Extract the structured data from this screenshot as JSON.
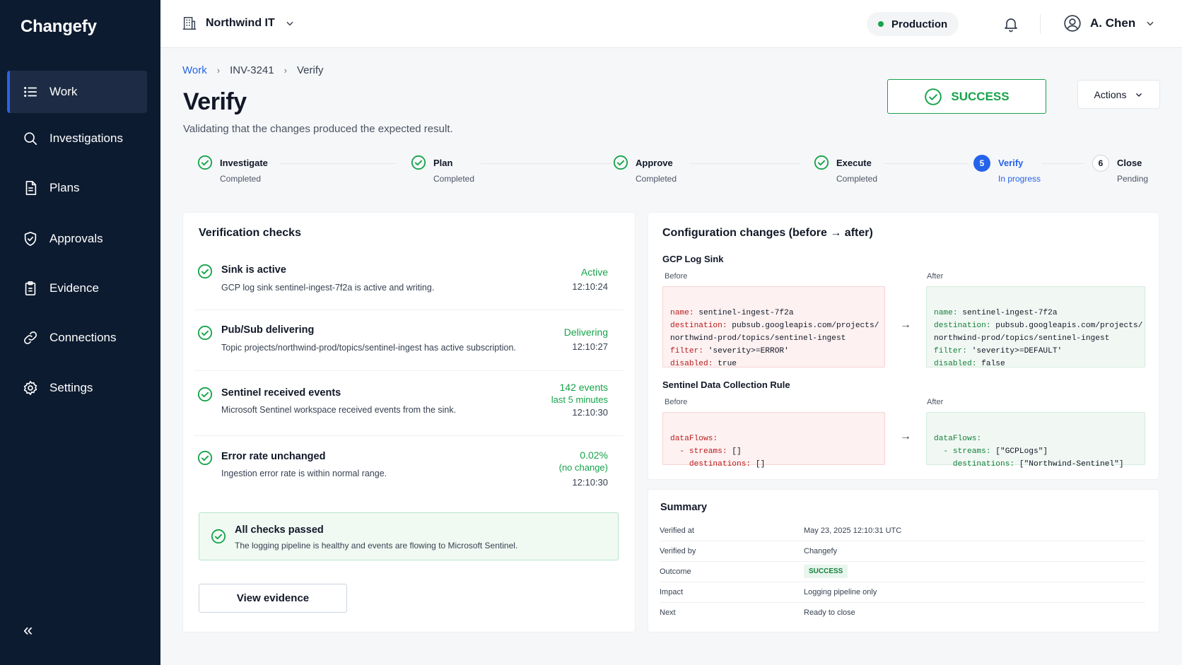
{
  "app": {
    "brand": "Changefy"
  },
  "sidebar": {
    "items": [
      {
        "label": "Work",
        "icon": "list-icon"
      },
      {
        "label": "Investigations",
        "icon": "search-icon"
      },
      {
        "label": "Plans",
        "icon": "document-icon"
      },
      {
        "label": "Approvals",
        "icon": "shield-check-icon"
      },
      {
        "label": "Evidence",
        "icon": "clipboard-icon"
      },
      {
        "label": "Connections",
        "icon": "link-icon"
      },
      {
        "label": "Settings",
        "icon": "gear-icon"
      }
    ],
    "collapse_glyph": "«"
  },
  "topbar": {
    "org": "Northwind IT",
    "environment": "Production",
    "user": "A. Chen"
  },
  "breadcrumb": {
    "root": "Work",
    "item": "INV-3241",
    "current": "Verify",
    "sep": "›"
  },
  "page": {
    "title": "Verify",
    "subtitle": "Validating that the changes produced the expected result.",
    "status_label": "SUCCESS",
    "actions_label": "Actions"
  },
  "steps": [
    {
      "label": "Investigate",
      "status": "Completed",
      "state": "done"
    },
    {
      "label": "Plan",
      "status": "Completed",
      "state": "done"
    },
    {
      "label": "Approve",
      "status": "Completed",
      "state": "done"
    },
    {
      "label": "Execute",
      "status": "Completed",
      "state": "done"
    },
    {
      "num": "5",
      "label": "Verify",
      "status": "In progress",
      "state": "current"
    },
    {
      "num": "6",
      "label": "Close",
      "status": "Pending",
      "state": "pending"
    }
  ],
  "checks": {
    "title": "Verification checks",
    "items": [
      {
        "title": "Sink is active",
        "desc": "GCP log sink sentinel-ingest-7f2a is active and writing.",
        "status": "Active",
        "extra": "",
        "time": "12:10:24"
      },
      {
        "title": "Pub/Sub delivering",
        "desc": "Topic projects/northwind-prod/topics/sentinel-ingest has active subscription.",
        "status": "Delivering",
        "extra": "",
        "time": "12:10:27"
      },
      {
        "title": "Sentinel received events",
        "desc": "Microsoft Sentinel workspace received events from the sink.",
        "status": "142 events",
        "extra": "last 5 minutes",
        "time": "12:10:30"
      },
      {
        "title": "Error rate unchanged",
        "desc": "Ingestion error rate is within normal range.",
        "status": "0.02%",
        "extra": "(no change)",
        "time": "12:10:30"
      }
    ],
    "all_passed_title": "All checks passed",
    "all_passed_desc": "The logging pipeline is healthy and events are flowing to Microsoft Sentinel.",
    "view_evidence": "View evidence"
  },
  "config": {
    "title": "Configuration changes (before → after)",
    "before_label": "Before",
    "after_label": "After",
    "arrow": "→",
    "sections": [
      {
        "name": "GCP Log Sink",
        "before": [
          {
            "k": "name:",
            "v": " sentinel-ingest-7f2a"
          },
          {
            "k": "destination:",
            "v": " pubsub.googleapis.com/projects/"
          },
          {
            "k": "",
            "v": "northwind-prod/topics/sentinel-ingest"
          },
          {
            "k": "filter:",
            "v": " 'severity>=ERROR'"
          },
          {
            "k": "disabled:",
            "v": " true"
          }
        ],
        "after": [
          {
            "k": "name:",
            "v": " sentinel-ingest-7f2a"
          },
          {
            "k": "destination:",
            "v": " pubsub.googleapis.com/projects/"
          },
          {
            "k": "",
            "v": "northwind-prod/topics/sentinel-ingest"
          },
          {
            "k": "filter:",
            "v": " 'severity>=DEFAULT'"
          },
          {
            "k": "disabled:",
            "v": " false"
          }
        ]
      },
      {
        "name": "Sentinel Data Collection Rule",
        "before": [
          {
            "k": "dataFlows:",
            "v": ""
          },
          {
            "k": "  - streams:",
            "v": " []"
          },
          {
            "k": "    destinations:",
            "v": " []"
          }
        ],
        "after": [
          {
            "k": "dataFlows:",
            "v": ""
          },
          {
            "k": "  - streams:",
            "v": " [\"GCPLogs\"]"
          },
          {
            "k": "    destinations:",
            "v": " [\"Northwind-Sentinel\"]"
          }
        ]
      }
    ]
  },
  "summary": {
    "title": "Summary",
    "rows": [
      {
        "label": "Verified at",
        "value": "May 23, 2025 12:10:31 UTC"
      },
      {
        "label": "Verified by",
        "value": "Changefy"
      },
      {
        "label": "Outcome",
        "value": "SUCCESS",
        "badge": true
      },
      {
        "label": "Impact",
        "value": "Logging pipeline only"
      },
      {
        "label": "Next",
        "value": "Ready to close"
      }
    ]
  },
  "colors": {
    "sidebar_bg": "#0d1b30",
    "accent": "#2563eb",
    "success": "#16a34a"
  }
}
